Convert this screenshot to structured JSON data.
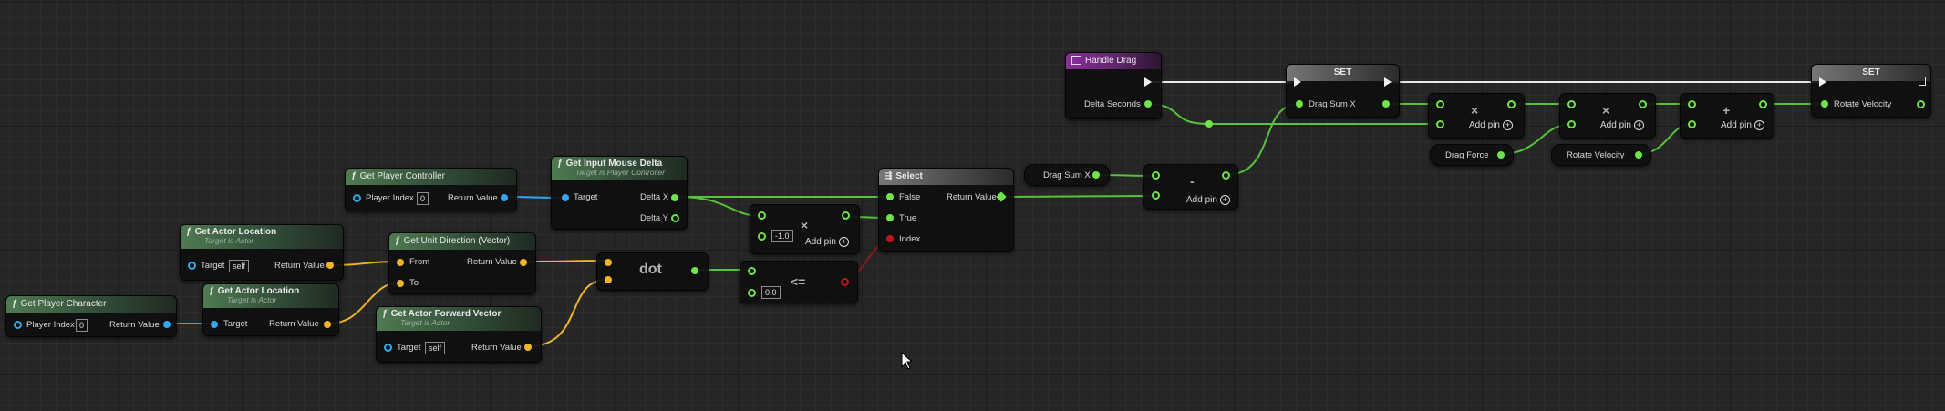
{
  "colors": {
    "bool": "#c01818",
    "float": "#6ee34a",
    "object": "#2ea8f0",
    "vector": "#f0b428",
    "exec": "#f2f2f2",
    "pure_header": "#4f7b52",
    "event_header": "#8a2f9a"
  },
  "nodes": {
    "get_player_character": {
      "title": "Get Player Character",
      "icon": "function-icon",
      "pins": {
        "player_index": "Player Index",
        "player_index_val": "0",
        "return_value": "Return Value"
      }
    },
    "get_actor_location_1": {
      "title": "Get Actor Location",
      "subtitle": "Target is Actor",
      "pins": {
        "target": "Target",
        "target_val": "self",
        "return_value": "Return Value"
      }
    },
    "get_actor_location_2": {
      "title": "Get Actor Location",
      "subtitle": "Target is Actor",
      "pins": {
        "target": "Target",
        "return_value": "Return Value"
      }
    },
    "get_player_controller": {
      "title": "Get Player Controller",
      "pins": {
        "player_index": "Player Index",
        "player_index_val": "0",
        "return_value": "Return Value"
      }
    },
    "get_unit_direction": {
      "title": "Get Unit Direction (Vector)",
      "pins": {
        "from": "From",
        "to": "To",
        "return_value": "Return Value"
      }
    },
    "get_actor_forward": {
      "title": "Get Actor Forward Vector",
      "subtitle": "Target is Actor",
      "pins": {
        "target": "Target",
        "target_val": "self",
        "return_value": "Return Value"
      }
    },
    "get_input_mouse_delta": {
      "title": "Get Input Mouse Delta",
      "subtitle": "Target is Player Controller",
      "pins": {
        "target": "Target",
        "delta_x": "Delta X",
        "delta_y": "Delta Y"
      }
    },
    "dot": {
      "label": "dot"
    },
    "multiply_1": {
      "op": "×",
      "value": "-1.0",
      "add_pin": "Add pin"
    },
    "less_equal": {
      "op": "<=",
      "value": "0.0"
    },
    "select": {
      "title": "Select",
      "pins": {
        "false": "False",
        "true": "True",
        "index": "Index",
        "return_value": "Return Value"
      }
    },
    "drag_sum_x_get": {
      "label": "Drag Sum X"
    },
    "subtract": {
      "op": "-",
      "add_pin": "Add pin"
    },
    "handle_drag": {
      "title": "Handle Drag",
      "pins": {
        "delta_seconds": "Delta Seconds"
      }
    },
    "set_1": {
      "title": "SET",
      "pins": {
        "drag_sum_x": "Drag Sum X"
      }
    },
    "multiply_2": {
      "op": "×",
      "add_pin": "Add pin"
    },
    "multiply_3": {
      "op": "×",
      "add_pin": "Add pin"
    },
    "add": {
      "op": "+",
      "add_pin": "Add pin"
    },
    "drag_force_get": {
      "label": "Drag Force"
    },
    "rotate_velocity_get": {
      "label": "Rotate Velocity"
    },
    "set_2": {
      "title": "SET",
      "pins": {
        "rotate_velocity": "Rotate Velocity"
      }
    }
  }
}
